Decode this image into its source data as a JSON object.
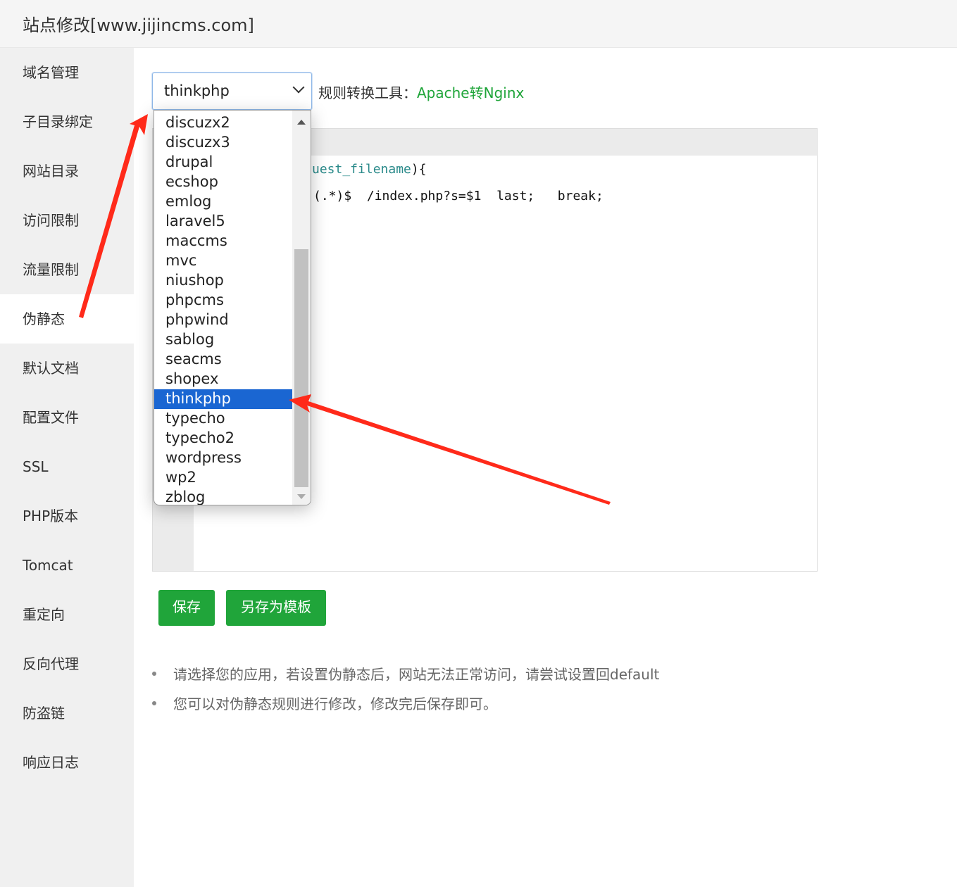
{
  "window": {
    "title": "站点修改[www.jijincms.com]"
  },
  "sidebar": {
    "items": [
      {
        "label": "域名管理"
      },
      {
        "label": "子目录绑定"
      },
      {
        "label": "网站目录"
      },
      {
        "label": "访问限制"
      },
      {
        "label": "流量限制"
      },
      {
        "label": "伪静态",
        "active": true
      },
      {
        "label": "默认文档"
      },
      {
        "label": "配置文件"
      },
      {
        "label": "SSL"
      },
      {
        "label": "PHP版本"
      },
      {
        "label": "Tomcat"
      },
      {
        "label": "重定向"
      },
      {
        "label": "反向代理"
      },
      {
        "label": "防盗链"
      },
      {
        "label": "响应日志"
      }
    ]
  },
  "rewrite": {
    "selected": "thinkphp",
    "converter_label": "规则转换工具：",
    "converter_link": "Apache转Nginx",
    "options": [
      "discuzx2",
      "discuzx3",
      "drupal",
      "ecshop",
      "emlog",
      "laravel5",
      "maccms",
      "mvc",
      "niushop",
      "phpcms",
      "phpwind",
      "sablog",
      "seacms",
      "shopex",
      "thinkphp",
      "typecho",
      "typecho2",
      "wordpress",
      "wp2",
      "zblog"
    ],
    "code_line1_var": "uest_filename",
    "code_line1_rest": "){",
    "code_line2": "(.*)$  /index.php?s=$1  last;   break;"
  },
  "buttons": {
    "save": "保存",
    "save_as_template": "另存为模板"
  },
  "tips": [
    "请选择您的应用，若设置伪静态后，网站无法正常访问，请尝试设置回default",
    "您可以对伪静态规则进行修改，修改完后保存即可。"
  ],
  "colors": {
    "accent_green": "#20a53a",
    "selection_blue": "#1a66d2",
    "annotation_red": "#ff2a1a"
  }
}
